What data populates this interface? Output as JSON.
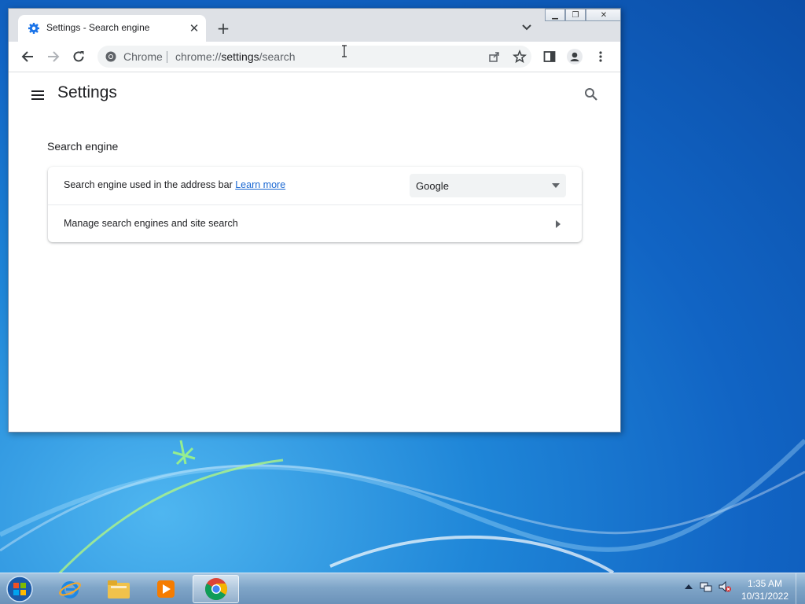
{
  "browser": {
    "tab": {
      "title": "Settings - Search engine"
    },
    "omnibox": {
      "chip": "Chrome",
      "url_scheme": "chrome://",
      "url_host": "settings",
      "url_path": "/search"
    }
  },
  "settings": {
    "page_title": "Settings",
    "section_title": "Search engine",
    "rows": [
      {
        "label": "Search engine used in the address bar",
        "link": "Learn more",
        "selected": "Google"
      },
      {
        "label": "Manage search engines and site search"
      }
    ]
  },
  "taskbar": {
    "time": "1:35 AM",
    "date": "10/31/2022",
    "apps": [
      "internet-explorer",
      "file-explorer",
      "media-player",
      "chrome"
    ]
  },
  "colors": {
    "accent": "#1a73e8",
    "link": "#1967d2",
    "desktop": "#1f86d8"
  }
}
